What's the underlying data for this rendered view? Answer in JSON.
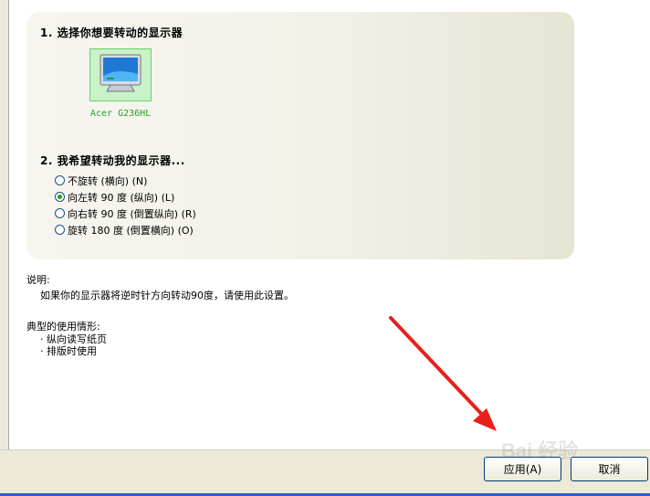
{
  "section1": {
    "title": "1. 选择你想要转动的显示器",
    "monitor_name": "Acer G236HL",
    "monitor_icon": "monitor-icon"
  },
  "section2": {
    "title": "2. 我希望转动我的显示器...",
    "options": [
      {
        "label": "不旋转 (横向) (N)",
        "selected": false
      },
      {
        "label": "向左转 90 度 (纵向) (L)",
        "selected": true
      },
      {
        "label": "向右转 90 度 (倒置纵向) (R)",
        "selected": false
      },
      {
        "label": "旋转 180 度 (倒置横向) (O)",
        "selected": false
      }
    ]
  },
  "description": {
    "title": "说明:",
    "text": "如果你的显示器将逆时针方向转动90度，请使用此设置。"
  },
  "usage": {
    "title": "典型的使用情形:",
    "items": [
      "纵向读写纸页",
      "排版时使用"
    ]
  },
  "buttons": {
    "apply": "应用(A)",
    "cancel": "取消"
  },
  "watermark": "Bai 经验",
  "colors": {
    "arrow": "#e8201a",
    "selected_radio": "#21a121",
    "monitor_tile": "#c9f2c9"
  }
}
